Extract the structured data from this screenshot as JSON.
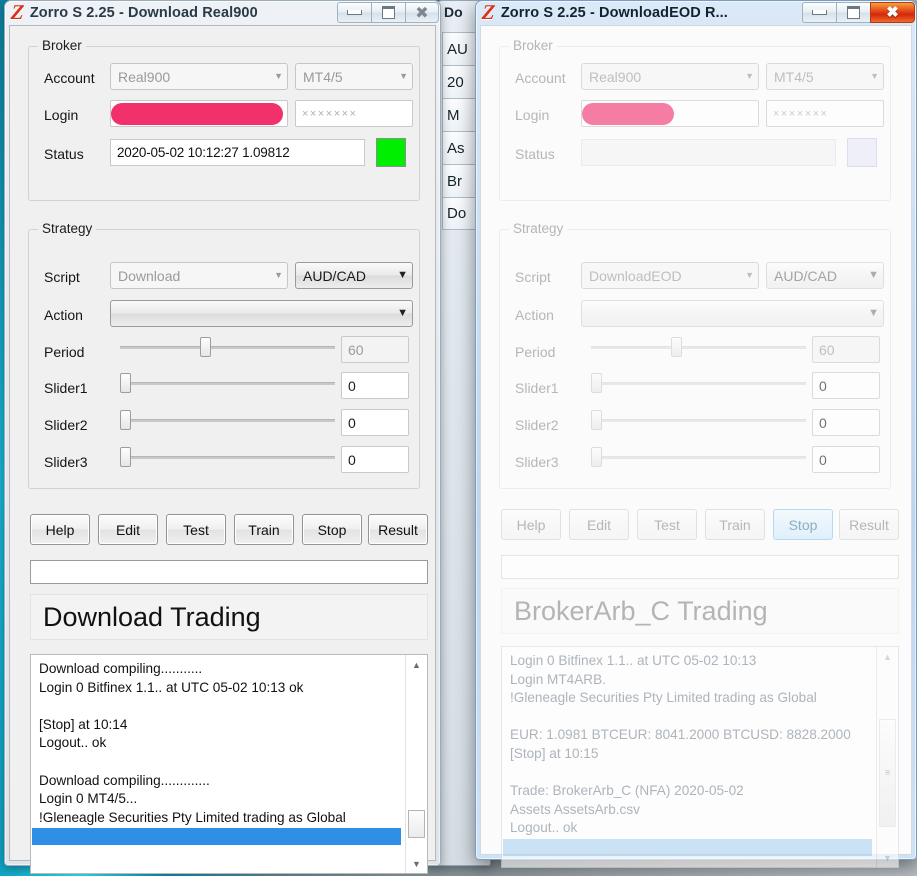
{
  "windows": {
    "left": {
      "title": "Zorro S 2.25 - Download Real900",
      "logo": "Z",
      "titlebuttons": {
        "minimize": "minimize-icon",
        "maximize": "maximize-icon",
        "close": "close-icon"
      },
      "broker": {
        "legend": "Broker",
        "account_label": "Account",
        "account_value": "Real900",
        "plugin_value": "MT4/5",
        "login_label": "Login",
        "login_value": "",
        "password_value": "×××××××",
        "status_label": "Status",
        "status_value": "2020-05-02 10:12:27   1.09812",
        "led_color": "#00ee00"
      },
      "strategy": {
        "legend": "Strategy",
        "script_label": "Script",
        "script_value": "Download",
        "asset_value": "AUD/CAD",
        "action_label": "Action",
        "action_value": "",
        "period_label": "Period",
        "period_value": "60",
        "period_pct": 37,
        "slider1_label": "Slider1",
        "slider1_value": "0",
        "slider1_pct": 0,
        "slider2_label": "Slider2",
        "slider2_value": "0",
        "slider2_pct": 0,
        "slider3_label": "Slider3",
        "slider3_value": "0",
        "slider3_pct": 0
      },
      "buttons": [
        "Help",
        "Edit",
        "Test",
        "Train",
        "Stop",
        "Result"
      ],
      "progress_value": "",
      "banner": "Download Trading",
      "log": [
        "Download compiling...........",
        "Login 0 Bitfinex 1.1.. at UTC 05-02 10:13 ok",
        "",
        "[Stop] at 10:14",
        "Logout.. ok",
        "",
        "Download compiling.............",
        "Login 0 MT4/5...",
        "!Gleneagle Securities Pty Limited trading as Global",
        ""
      ],
      "scroll": {
        "up": "▲",
        "down": "▼",
        "grip": ""
      }
    },
    "middle": {
      "title": "Do",
      "items": [
        "AU",
        "20",
        "M",
        "As",
        "Br",
        "Do"
      ]
    },
    "right": {
      "title": "Zorro S 2.25 - DownloadEOD R...",
      "logo": "Z",
      "titlebuttons": {
        "minimize": "minimize-icon",
        "maximize": "maximize-icon",
        "close": "close-icon"
      },
      "broker": {
        "legend": "Broker",
        "account_label": "Account",
        "account_value": "Real900",
        "plugin_value": "MT4/5",
        "login_label": "Login",
        "login_value": "",
        "password_value": "×××××××",
        "status_label": "Status",
        "status_value": "",
        "led_color": "#e7e9f7"
      },
      "strategy": {
        "legend": "Strategy",
        "script_label": "Script",
        "script_value": "DownloadEOD",
        "asset_value": "AUD/CAD",
        "action_label": "Action",
        "action_value": "",
        "period_label": "Period",
        "period_value": "60",
        "period_pct": 37,
        "slider1_label": "Slider1",
        "slider1_value": "0",
        "slider1_pct": 0,
        "slider2_label": "Slider2",
        "slider2_value": "0",
        "slider2_pct": 0,
        "slider3_label": "Slider3",
        "slider3_value": "0",
        "slider3_pct": 0
      },
      "buttons": [
        "Help",
        "Edit",
        "Test",
        "Train",
        "Stop",
        "Result"
      ],
      "active_button": "Stop",
      "progress_value": "",
      "banner": "BrokerArb_C Trading",
      "log": [
        "Login 0 Bitfinex 1.1.. at UTC 05-02 10:13",
        "Login MT4ARB.",
        "!Gleneagle Securities Pty Limited trading as Global",
        "",
        "EUR: 1.0981 BTCEUR: 8041.2000 BTCUSD: 8828.2000",
        "[Stop] at 10:15",
        "",
        "Trade: BrokerArb_C  (NFA) 2020-05-02",
        "Assets AssetsArb.csv",
        "Logout.. ok",
        ""
      ],
      "scroll": {
        "up": "▲",
        "down": "▼",
        "grip": "≡"
      }
    }
  }
}
